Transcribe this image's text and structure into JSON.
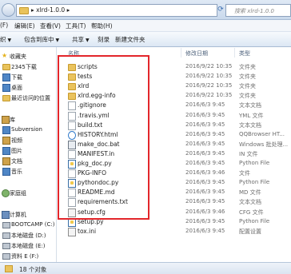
{
  "address": {
    "breadcrumb": "xlrd-1.0.0",
    "search_placeholder": "搜索 xlrd-1.0.0"
  },
  "menu": [
    "(F)",
    "编辑(E)",
    "查看(V)",
    "工具(T)",
    "帮助(H)"
  ],
  "toolbar": {
    "organize": "织",
    "include": "包含到库中",
    "share": "共享",
    "burn": "刻录",
    "new_folder": "新建文件夹"
  },
  "nav": {
    "favorites": "收藏夹",
    "items": [
      "2345下载",
      "下载",
      "桌面",
      "最近访问的位置"
    ],
    "libraries": "库",
    "lib_items": [
      "Subversion",
      "视频",
      "图片",
      "文档",
      "音乐"
    ],
    "homegroup": "家庭组",
    "computer": "计算机",
    "drives": [
      "BOOTCAMP (C:)",
      "本地磁盘 (D:)",
      "本地磁盘 (E:)",
      "资料 E (F:)"
    ],
    "network": "网络"
  },
  "columns": {
    "name": "名称",
    "date": "修改日期",
    "type": "类型"
  },
  "files": [
    {
      "name": "scripts",
      "date": "2016/9/22 10:35",
      "type": "文件夹",
      "icon": "folder"
    },
    {
      "name": "tests",
      "date": "2016/9/22 10:35",
      "type": "文件夹",
      "icon": "folder"
    },
    {
      "name": "xlrd",
      "date": "2016/9/22 10:35",
      "type": "文件夹",
      "icon": "folder"
    },
    {
      "name": "xlrd.egg-info",
      "date": "2016/9/22 10:35",
      "type": "文件夹",
      "icon": "folder"
    },
    {
      "name": ".gitignore",
      "date": "2016/6/3 9:45",
      "type": "文本文档",
      "icon": "doc"
    },
    {
      "name": ".travis.yml",
      "date": "2016/6/3 9:45",
      "type": "YML 文件",
      "icon": "doc"
    },
    {
      "name": "build.txt",
      "date": "2016/6/3 9:45",
      "type": "文本文档",
      "icon": "doc"
    },
    {
      "name": "HISTORY.html",
      "date": "2016/6/3 9:45",
      "type": "QQBrowser HT...",
      "icon": "html"
    },
    {
      "name": "make_doc.bat",
      "date": "2016/6/3 9:45",
      "type": "Windows 批处理...",
      "icon": "bat"
    },
    {
      "name": "MANIFEST.in",
      "date": "2016/6/3 9:45",
      "type": "IN 文件",
      "icon": "doc"
    },
    {
      "name": "pkg_doc.py",
      "date": "2016/6/3 9:45",
      "type": "Python File",
      "icon": "py"
    },
    {
      "name": "PKG-INFO",
      "date": "2016/6/3 9:46",
      "type": "文件",
      "icon": "doc"
    },
    {
      "name": "pythondoc.py",
      "date": "2016/6/3 9:45",
      "type": "Python File",
      "icon": "py"
    },
    {
      "name": "README.md",
      "date": "2016/6/3 9:45",
      "type": "MD 文件",
      "icon": "doc"
    },
    {
      "name": "requirements.txt",
      "date": "2016/6/3 9:45",
      "type": "文本文档",
      "icon": "doc"
    },
    {
      "name": "setup.cfg",
      "date": "2016/6/3 9:46",
      "type": "CFG 文件",
      "icon": "cfg"
    },
    {
      "name": "setup.py",
      "date": "2016/6/3 9:45",
      "type": "Python File",
      "icon": "py"
    },
    {
      "name": "tox.ini",
      "date": "2016/6/3 9:45",
      "type": "配置设置",
      "icon": "cfg"
    }
  ],
  "status": {
    "count": "18 个对象"
  },
  "colors": {
    "highlight": "#e3262b",
    "folder": "#eac35d"
  }
}
